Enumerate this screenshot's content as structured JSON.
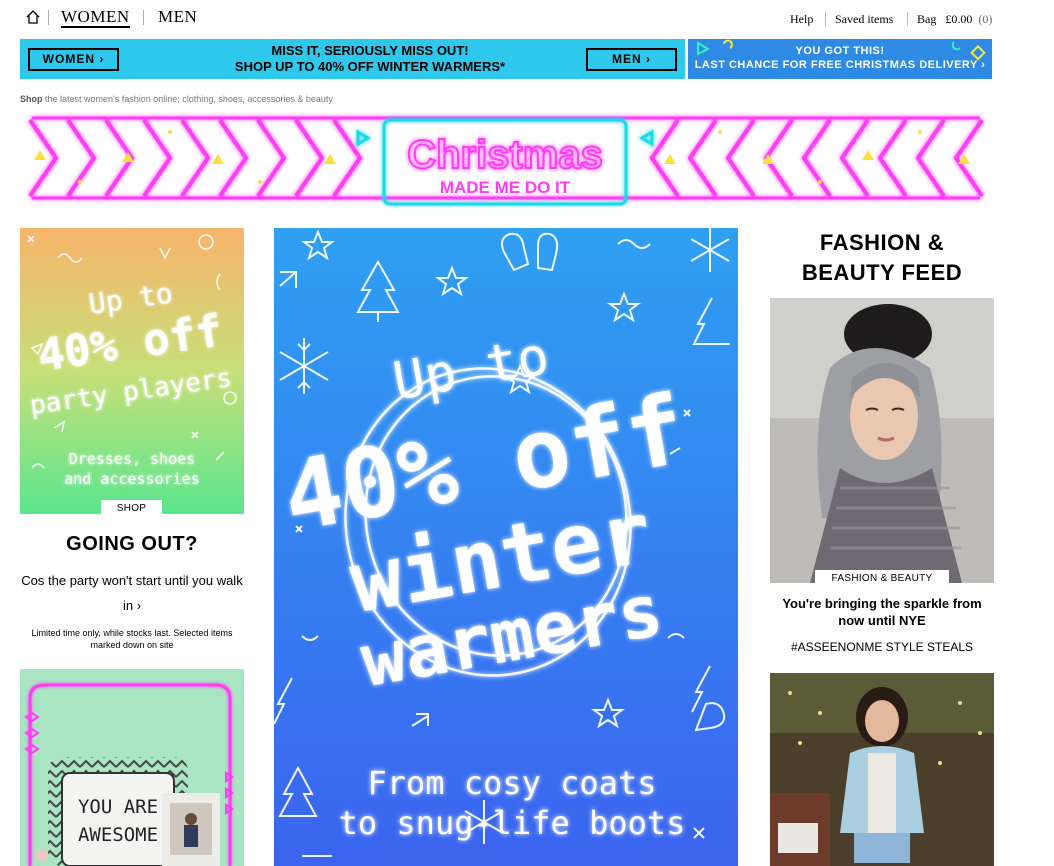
{
  "topnav": {
    "women_label": "WOMEN",
    "men_label": "MEN",
    "help_label": "Help",
    "saved_label": "Saved items",
    "bag_label": "Bag",
    "bag_total": "£0.00",
    "bag_count": "(0)",
    "home_icon": "home-icon"
  },
  "promo": {
    "women_button": "WOMEN ›",
    "men_button": "MEN ›",
    "headline_line1": "MISS IT, SERIOUSLY MISS OUT!",
    "headline_line2": "SHOP UP TO 40% OFF WINTER WARMERS*",
    "right_line1": "YOU GOT THIS!",
    "right_line2": "LAST CHANCE FOR FREE CHRISTMAS DELIVERY ›",
    "left_color": "#2ec8ec",
    "right_color": "#2f8ae6"
  },
  "shop_line": {
    "bold": "Shop",
    "rest": " the latest women's fashion online; clothing, shoes, accessories & beauty"
  },
  "xmas_banner": {
    "title": "Christmas",
    "subtitle": "MADE ME DO IT",
    "neon_pink": "#ff3df5",
    "neon_cyan": "#1fd9ea"
  },
  "party_tile": {
    "line1": "Up to",
    "line2": "40% off",
    "line3": "party players",
    "sub1": "Dresses, shoes",
    "sub2": "and accessories",
    "shop_label": "SHOP"
  },
  "going_out": {
    "title": "GOING OUT?",
    "subtitle": "Cos the party won't start until you walk in ›",
    "small_print": "Limited time only, while stocks last. Selected items marked down on site"
  },
  "pillow_tile": {
    "pillow_line1": "YOU ARE",
    "pillow_line2": "AWESOME"
  },
  "hero": {
    "line1": "Up to",
    "line2": "40% off",
    "line3": "winter",
    "line4": "warmers",
    "sub1": "From cosy coats",
    "sub2": "to snug-life boots"
  },
  "feed": {
    "title_line1": "FASHION &",
    "title_line2": "BEAUTY FEED",
    "tag": "FASHION & BEAUTY",
    "caption": "You're bringing the sparkle from now until NYE",
    "hashtag": "#ASSEENONME STYLE STEALS"
  }
}
